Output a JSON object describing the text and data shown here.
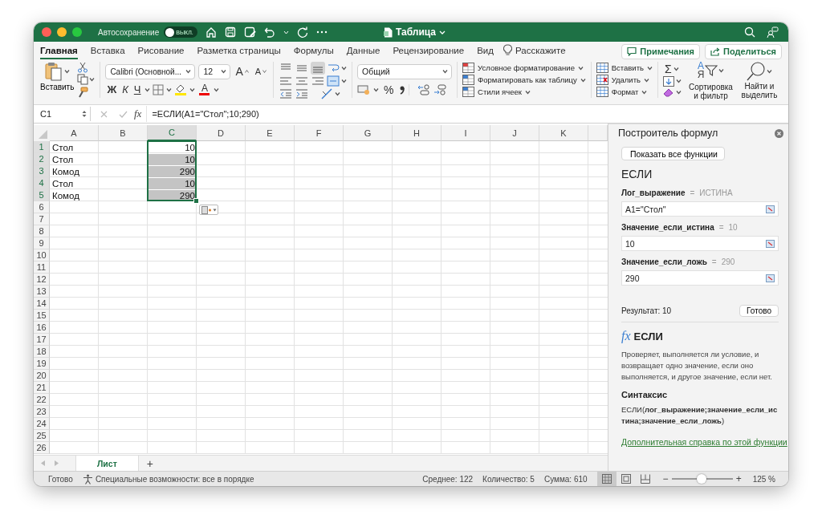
{
  "window": {
    "title": "Таблица"
  },
  "autosave": {
    "label": "Автосохранение",
    "on": false,
    "state_text": "ВЫКЛ."
  },
  "ribbon_tabs": [
    {
      "label": "Главная",
      "selected": true
    },
    {
      "label": "Вставка",
      "selected": false
    },
    {
      "label": "Рисование",
      "selected": false
    },
    {
      "label": "Разметка страницы",
      "selected": false
    },
    {
      "label": "Формулы",
      "selected": false
    },
    {
      "label": "Данные",
      "selected": false
    },
    {
      "label": "Рецензирование",
      "selected": false
    },
    {
      "label": "Вид",
      "selected": false
    }
  ],
  "tell_me": "Расскажите",
  "comments_button": "Примечания",
  "share_button": "Поделиться",
  "ribbon": {
    "paste": "Вставить",
    "font": "Calibri (Основной...",
    "font_size": "12",
    "grow_font": "A",
    "shrink_font": "A",
    "bold": "Ж",
    "italic": "К",
    "underline": "Ч",
    "font_color": "A",
    "vertical_align": [
      {
        "selected": false
      },
      {
        "selected": false
      },
      {
        "selected": true
      }
    ],
    "number_format": "Общий",
    "percent": "%",
    "styles": [
      "Условное форматирование",
      "Форматировать как таблицу",
      "Стили ячеек"
    ],
    "cells": [
      "Вставить",
      "Удалить",
      "Формат"
    ],
    "sum": "Σ",
    "sort_letters": [
      "А",
      "Я"
    ],
    "sort": "Сортировка и фильтр",
    "find": "Найти и выделить"
  },
  "formula_bar": {
    "name_box": "C1",
    "fx": "fx",
    "formula": "=ЕСЛИ(A1=\"Стол\";10;290)"
  },
  "columns": [
    {
      "label": "A",
      "selected": false
    },
    {
      "label": "B",
      "selected": false
    },
    {
      "label": "C",
      "selected": true
    },
    {
      "label": "D",
      "selected": false
    },
    {
      "label": "E",
      "selected": false
    },
    {
      "label": "F",
      "selected": false
    },
    {
      "label": "G",
      "selected": false
    },
    {
      "label": "H",
      "selected": false
    },
    {
      "label": "I",
      "selected": false
    },
    {
      "label": "J",
      "selected": false
    },
    {
      "label": "K",
      "selected": false
    }
  ],
  "rows": [
    {
      "label": "1",
      "selected": true,
      "cells": [
        {
          "text": "Стол",
          "kind": "text"
        },
        null,
        {
          "text": "10",
          "kind": "number",
          "active": true
        }
      ]
    },
    {
      "label": "2",
      "selected": true,
      "cells": [
        {
          "text": "Стол",
          "kind": "text"
        },
        null,
        {
          "text": "10",
          "kind": "number",
          "active": false
        }
      ]
    },
    {
      "label": "3",
      "selected": true,
      "cells": [
        {
          "text": "Комод",
          "kind": "text"
        },
        null,
        {
          "text": "290",
          "kind": "number",
          "active": false
        }
      ]
    },
    {
      "label": "4",
      "selected": true,
      "cells": [
        {
          "text": "Стол",
          "kind": "text"
        },
        null,
        {
          "text": "10",
          "kind": "number",
          "active": false
        }
      ]
    },
    {
      "label": "5",
      "selected": true,
      "cells": [
        {
          "text": "Комод",
          "kind": "text"
        },
        null,
        {
          "text": "290",
          "kind": "number",
          "active": false
        }
      ]
    },
    {
      "label": "6",
      "selected": false,
      "cells": []
    },
    {
      "label": "7",
      "selected": false,
      "cells": []
    },
    {
      "label": "8",
      "selected": false,
      "cells": []
    },
    {
      "label": "9",
      "selected": false,
      "cells": []
    },
    {
      "label": "10",
      "selected": false,
      "cells": []
    },
    {
      "label": "11",
      "selected": false,
      "cells": []
    },
    {
      "label": "12",
      "selected": false,
      "cells": []
    },
    {
      "label": "13",
      "selected": false,
      "cells": []
    },
    {
      "label": "14",
      "selected": false,
      "cells": []
    },
    {
      "label": "15",
      "selected": false,
      "cells": []
    },
    {
      "label": "16",
      "selected": false,
      "cells": []
    },
    {
      "label": "17",
      "selected": false,
      "cells": []
    },
    {
      "label": "18",
      "selected": false,
      "cells": []
    },
    {
      "label": "19",
      "selected": false,
      "cells": []
    },
    {
      "label": "20",
      "selected": false,
      "cells": []
    },
    {
      "label": "21",
      "selected": false,
      "cells": []
    },
    {
      "label": "22",
      "selected": false,
      "cells": []
    },
    {
      "label": "23",
      "selected": false,
      "cells": []
    },
    {
      "label": "24",
      "selected": false,
      "cells": []
    },
    {
      "label": "25",
      "selected": false,
      "cells": []
    },
    {
      "label": "26",
      "selected": false,
      "cells": []
    }
  ],
  "sheet_tabs": [
    {
      "label": "Лист",
      "selected": true
    }
  ],
  "add_sheet": "+",
  "formula_builder": {
    "title": "Построитель формул",
    "back_button": "Показать все функции",
    "function": "ЕСЛИ",
    "arguments": [
      {
        "name": "Лог_выражение",
        "equals": "=",
        "result": "ИСТИНА",
        "value": "A1=\"Стол\""
      },
      {
        "name": "Значение_если_истина",
        "equals": "=",
        "result": "10",
        "value": "10"
      },
      {
        "name": "Значение_если_ложь",
        "equals": "=",
        "result": "290",
        "value": "290"
      }
    ],
    "result": "Результат: 10",
    "done_button": "Готово",
    "fx": "fx",
    "help_title": "ЕСЛИ",
    "description": "Проверяет, выполняется ли условие, и возвращает одно значение, если оно выполняется, и другое значение, если нет.",
    "syntax_title": "Синтаксис",
    "syntax": "ЕСЛИ(**лог_выражение;значение_если_истина;значение_если_ложь**)",
    "help_link": "Дополнительная справка по этой функции"
  },
  "status_bar": {
    "state": "Готово",
    "accessibility": "Специальные возможности: все в порядке",
    "average": "Среднее: 122",
    "count": "Количество: 5",
    "sum": "Сумма: 610",
    "views": [
      {
        "kind": "normal",
        "selected": true
      },
      {
        "kind": "page_layout",
        "selected": false
      },
      {
        "kind": "page_break",
        "selected": false
      }
    ],
    "zoom_out": "−",
    "zoom_in": "+",
    "zoom": {
      "level": 0.49
    },
    "zoom_text": "125 %"
  }
}
